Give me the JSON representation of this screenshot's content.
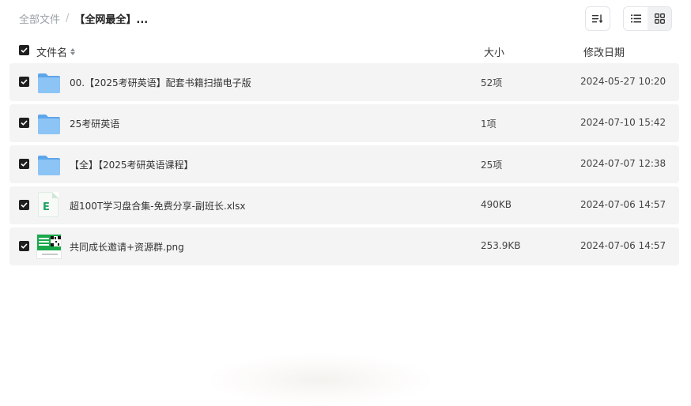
{
  "breadcrumb": {
    "root": "全部文件",
    "separator": "/",
    "current": "【全网最全】..."
  },
  "toolbar": {
    "sort_icon": "sort-descending-icon",
    "list_view_icon": "list-view-icon",
    "grid_view_icon": "grid-view-icon",
    "active_view": "list"
  },
  "columns": {
    "name": "文件名",
    "size": "大小",
    "date": "修改日期"
  },
  "files": [
    {
      "name": "00.【2025考研英语】配套书籍扫描电子版",
      "size": "52项",
      "date": "2024-05-27 10:20",
      "type": "folder",
      "checked": true
    },
    {
      "name": "25考研英语",
      "size": "1项",
      "date": "2024-07-10 15:42",
      "type": "folder",
      "checked": true
    },
    {
      "name": "【全】【2025考研英语课程】",
      "size": "25项",
      "date": "2024-07-07 12:38",
      "type": "folder",
      "checked": true
    },
    {
      "name": "超100T学习盘合集-免费分享-副班长.xlsx",
      "size": "490KB",
      "date": "2024-07-06 14:57",
      "type": "xlsx",
      "checked": true
    },
    {
      "name": "共同成长邀请+资源群.png",
      "size": "253.9KB",
      "date": "2024-07-06 14:57",
      "type": "png",
      "checked": true
    }
  ],
  "xlsx_letter": "E",
  "colors": {
    "row_bg": "#f4f4f5",
    "folder": "#74b6f0",
    "checkbox": "#1f1f1f",
    "xlsx_green": "#21a366",
    "png_green": "#1aa94a"
  }
}
